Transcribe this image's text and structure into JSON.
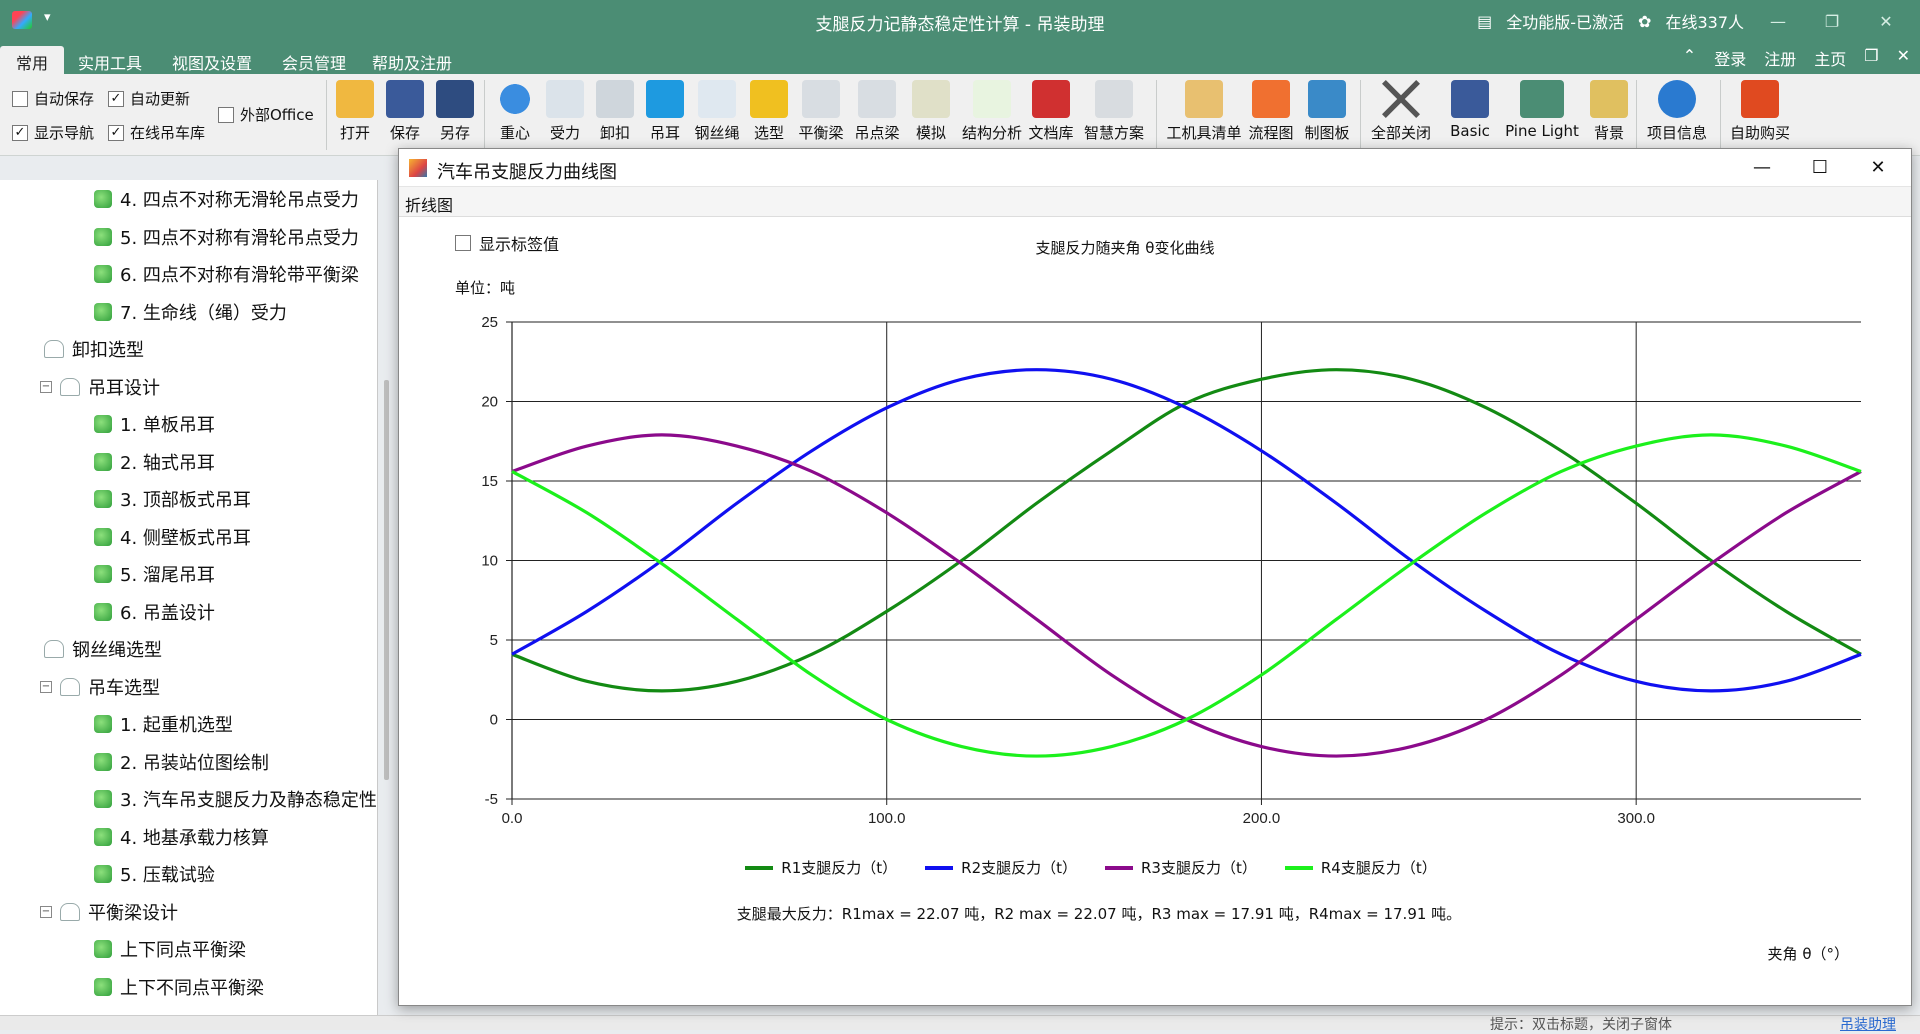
{
  "window": {
    "title": "支腿反力记静态稳定性计算 - 吊装助理",
    "edition": "全功能版-已激活",
    "online": "在线337人"
  },
  "menu": {
    "tabs": [
      "常用",
      "实用工具",
      "视图及设置",
      "会员管理",
      "帮助及注册"
    ],
    "right": [
      "登录",
      "注册",
      "主页"
    ]
  },
  "ribbon": {
    "checks": [
      {
        "label": "自动保存",
        "checked": false
      },
      {
        "label": "自动更新",
        "checked": true
      },
      {
        "label": "外部Office",
        "checked": false
      },
      {
        "label": "显示导航",
        "checked": true
      },
      {
        "label": "在线吊车库",
        "checked": true
      }
    ],
    "buttons": [
      "打开",
      "保存",
      "另存",
      "重心",
      "受力",
      "卸扣",
      "吊耳",
      "钢丝绳",
      "选型",
      "平衡梁",
      "吊点梁",
      "模拟",
      "结构分析",
      "文档库",
      "智慧方案",
      "工机具清单",
      "流程图",
      "制图板",
      "全部关闭",
      "Basic",
      "Pine Light",
      "背景",
      "项目信息",
      "自助购买"
    ]
  },
  "sidebar": {
    "items": [
      {
        "label": "4. 四点不对称无滑轮吊点受力",
        "level": 2
      },
      {
        "label": "5. 四点不对称有滑轮吊点受力",
        "level": 2
      },
      {
        "label": "6. 四点不对称有滑轮带平衡梁",
        "level": 2
      },
      {
        "label": "7. 生命线（绳）受力",
        "level": 2
      },
      {
        "label": "卸扣选型",
        "level": 1
      },
      {
        "label": "吊耳设计",
        "level": 1
      },
      {
        "label": "1. 单板吊耳",
        "level": 2
      },
      {
        "label": "2. 轴式吊耳",
        "level": 2
      },
      {
        "label": "3. 顶部板式吊耳",
        "level": 2
      },
      {
        "label": "4. 侧壁板式吊耳",
        "level": 2
      },
      {
        "label": "5. 溜尾吊耳",
        "level": 2
      },
      {
        "label": "6. 吊盖设计",
        "level": 2
      },
      {
        "label": "钢丝绳选型",
        "level": 1
      },
      {
        "label": "吊车选型",
        "level": 1
      },
      {
        "label": "1. 起重机选型",
        "level": 2
      },
      {
        "label": "2. 吊装站位图绘制",
        "level": 2
      },
      {
        "label": "3. 汽车吊支腿反力及静态稳定性",
        "level": 2
      },
      {
        "label": "4. 地基承载力核算",
        "level": 2
      },
      {
        "label": "5. 压载试验",
        "level": 2
      },
      {
        "label": "平衡梁设计",
        "level": 1
      },
      {
        "label": "上下同点平衡梁",
        "level": 2
      },
      {
        "label": "上下不同点平衡梁",
        "level": 2
      }
    ]
  },
  "status": {
    "hint": "提示：双击标题，关闭子窗体",
    "link": "吊装助理"
  },
  "dialog": {
    "title": "汽车吊支腿反力曲线图",
    "tab": "折线图",
    "show_labels": "显示标签值",
    "unit": "单位：吨",
    "max_info": "支腿最大反力：R1max = 22.07 吨，R2 max = 22.07 吨，R3 max = 17.91 吨，R4max = 17.91 吨。"
  },
  "chart_data": {
    "type": "line",
    "title": "支腿反力随夹角 θ变化曲线",
    "xlabel": "夹角 θ（°）",
    "ylabel": "",
    "xlim": [
      0,
      360
    ],
    "ylim": [
      -5,
      25
    ],
    "xticks": [
      "0.0",
      "100.0",
      "200.0",
      "300.0"
    ],
    "yticks": [
      "-5",
      "0",
      "5",
      "10",
      "15",
      "20",
      "25"
    ],
    "grid": true,
    "legend": "bottom",
    "x": [
      0,
      20,
      40,
      60,
      80,
      100,
      120,
      140,
      160,
      180,
      200,
      220,
      240,
      260,
      280,
      300,
      320,
      340,
      360
    ],
    "series": [
      {
        "name": "R1支腿反力（t）",
        "color": "#138a13",
        "values": [
          4.1,
          2.4,
          1.8,
          2.4,
          4.1,
          6.8,
          10.0,
          13.6,
          16.9,
          19.9,
          21.4,
          22.0,
          21.4,
          19.6,
          16.9,
          13.6,
          10.0,
          6.8,
          4.1
        ]
      },
      {
        "name": "R2支腿反力（t）",
        "color": "#1010f0",
        "values": [
          4.1,
          6.8,
          10.0,
          13.6,
          16.9,
          19.6,
          21.4,
          22.0,
          21.4,
          19.6,
          16.9,
          13.6,
          10.0,
          6.8,
          4.1,
          2.4,
          1.8,
          2.4,
          4.1
        ]
      },
      {
        "name": "R3支腿反力（t）",
        "color": "#8b0a8b",
        "values": [
          15.6,
          17.2,
          17.9,
          17.2,
          15.6,
          13.0,
          9.8,
          6.3,
          2.8,
          0.0,
          -1.7,
          -2.3,
          -1.7,
          0.0,
          2.8,
          6.3,
          9.8,
          13.0,
          15.6
        ]
      },
      {
        "name": "R4支腿反力（t）",
        "color": "#1cf01c",
        "values": [
          15.6,
          13.0,
          9.8,
          6.3,
          2.8,
          0.0,
          -1.7,
          -2.3,
          -1.7,
          0.0,
          2.8,
          6.3,
          9.8,
          13.0,
          15.6,
          17.2,
          17.9,
          17.2,
          15.6
        ]
      }
    ]
  }
}
